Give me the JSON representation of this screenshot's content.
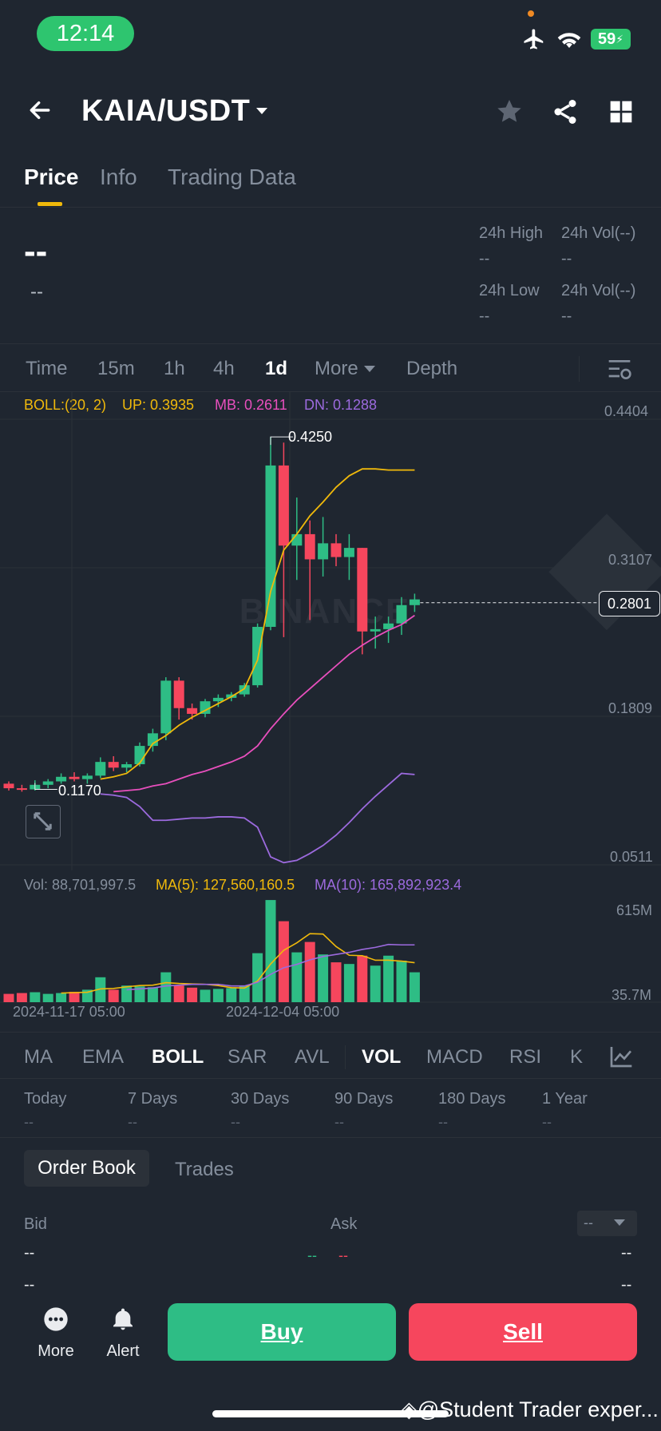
{
  "status_bar": {
    "time": "12:14",
    "battery": "59"
  },
  "header": {
    "pair": "KAIA/USDT"
  },
  "tabs": [
    "Price",
    "Info",
    "Trading Data"
  ],
  "price": {
    "last": "--",
    "sub": "--",
    "high_label": "24h High",
    "high_value": "--",
    "vol1_label": "24h Vol(--)",
    "vol1_value": "--",
    "low_label": "24h Low",
    "low_value": "--",
    "vol2_label": "24h Vol(--)",
    "vol2_value": "--"
  },
  "intervals": [
    "Time",
    "15m",
    "1h",
    "4h",
    "1d",
    "More",
    "Depth"
  ],
  "active_interval": "1d",
  "boll": {
    "label": "BOLL:(20, 2)",
    "up": "UP: 0.3935",
    "mb": "MB: 0.2611",
    "dn": "DN: 0.1288"
  },
  "vol_legend": {
    "vol": "Vol: 88,701,997.5",
    "ma5": "MA(5): 127,560,160.5",
    "ma10": "MA(10): 165,892,923.4"
  },
  "chart_data": {
    "type": "candlestick",
    "y_axis_labels": [
      "0.4404",
      "0.3107",
      "0.1809",
      "0.0511"
    ],
    "ylim": [
      0.0511,
      0.4404
    ],
    "current_price": "0.2801",
    "high_marker": "0.4250",
    "low_marker": "0.1170",
    "x_labels": [
      "2024-11-17 05:00",
      "2024-12-04 05:00"
    ],
    "volume_axis_labels": [
      "615M",
      "35.7M"
    ],
    "candles": [
      {
        "o": 0.122,
        "h": 0.124,
        "l": 0.116,
        "c": 0.118
      },
      {
        "o": 0.118,
        "h": 0.121,
        "l": 0.115,
        "c": 0.117
      },
      {
        "o": 0.117,
        "h": 0.125,
        "l": 0.116,
        "c": 0.121
      },
      {
        "o": 0.121,
        "h": 0.126,
        "l": 0.118,
        "c": 0.124
      },
      {
        "o": 0.124,
        "h": 0.131,
        "l": 0.122,
        "c": 0.128
      },
      {
        "o": 0.128,
        "h": 0.132,
        "l": 0.124,
        "c": 0.126
      },
      {
        "o": 0.126,
        "h": 0.131,
        "l": 0.122,
        "c": 0.129
      },
      {
        "o": 0.129,
        "h": 0.145,
        "l": 0.127,
        "c": 0.141
      },
      {
        "o": 0.141,
        "h": 0.146,
        "l": 0.133,
        "c": 0.136
      },
      {
        "o": 0.136,
        "h": 0.141,
        "l": 0.132,
        "c": 0.139
      },
      {
        "o": 0.139,
        "h": 0.158,
        "l": 0.137,
        "c": 0.155
      },
      {
        "o": 0.155,
        "h": 0.17,
        "l": 0.15,
        "c": 0.166
      },
      {
        "o": 0.166,
        "h": 0.215,
        "l": 0.16,
        "c": 0.212
      },
      {
        "o": 0.212,
        "h": 0.215,
        "l": 0.178,
        "c": 0.188
      },
      {
        "o": 0.188,
        "h": 0.192,
        "l": 0.178,
        "c": 0.183
      },
      {
        "o": 0.183,
        "h": 0.196,
        "l": 0.18,
        "c": 0.194
      },
      {
        "o": 0.194,
        "h": 0.2,
        "l": 0.189,
        "c": 0.197
      },
      {
        "o": 0.197,
        "h": 0.202,
        "l": 0.194,
        "c": 0.2
      },
      {
        "o": 0.2,
        "h": 0.21,
        "l": 0.198,
        "c": 0.208
      },
      {
        "o": 0.208,
        "h": 0.262,
        "l": 0.206,
        "c": 0.259
      },
      {
        "o": 0.259,
        "h": 0.425,
        "l": 0.256,
        "c": 0.4
      },
      {
        "o": 0.4,
        "h": 0.42,
        "l": 0.25,
        "c": 0.33
      },
      {
        "o": 0.33,
        "h": 0.372,
        "l": 0.3,
        "c": 0.34
      },
      {
        "o": 0.34,
        "h": 0.352,
        "l": 0.265,
        "c": 0.318
      },
      {
        "o": 0.318,
        "h": 0.355,
        "l": 0.303,
        "c": 0.332
      },
      {
        "o": 0.332,
        "h": 0.34,
        "l": 0.312,
        "c": 0.32
      },
      {
        "o": 0.32,
        "h": 0.34,
        "l": 0.3,
        "c": 0.328
      },
      {
        "o": 0.328,
        "h": 0.328,
        "l": 0.235,
        "c": 0.255
      },
      {
        "o": 0.255,
        "h": 0.268,
        "l": 0.24,
        "c": 0.257
      },
      {
        "o": 0.257,
        "h": 0.268,
        "l": 0.245,
        "c": 0.262
      },
      {
        "o": 0.262,
        "h": 0.285,
        "l": 0.252,
        "c": 0.278
      },
      {
        "o": 0.278,
        "h": 0.288,
        "l": 0.272,
        "c": 0.283
      }
    ],
    "up_band": [
      null,
      null,
      null,
      null,
      null,
      null,
      null,
      0.126,
      0.128,
      0.131,
      0.14,
      0.157,
      0.164,
      0.173,
      0.18,
      0.186,
      0.192,
      0.198,
      0.205,
      0.23,
      0.29,
      0.326,
      0.34,
      0.356,
      0.368,
      0.381,
      0.391,
      0.397,
      0.397,
      0.396,
      0.396,
      0.396
    ],
    "mid_band": [
      null,
      null,
      null,
      null,
      null,
      null,
      null,
      null,
      0.115,
      0.116,
      0.117,
      0.12,
      0.122,
      0.126,
      0.13,
      0.133,
      0.137,
      0.141,
      0.146,
      0.155,
      0.17,
      0.183,
      0.195,
      0.205,
      0.215,
      0.225,
      0.235,
      0.243,
      0.25,
      0.256,
      0.261,
      0.269
    ],
    "dn_band": [
      null,
      null,
      null,
      null,
      null,
      null,
      null,
      0.113,
      0.112,
      0.11,
      0.102,
      0.09,
      0.09,
      0.091,
      0.092,
      0.092,
      0.093,
      0.093,
      0.092,
      0.084,
      0.058,
      0.053,
      0.055,
      0.061,
      0.068,
      0.077,
      0.088,
      0.1,
      0.111,
      0.121,
      0.131,
      0.13
    ],
    "volumes": [
      20,
      22,
      24,
      20,
      22,
      25,
      30,
      60,
      30,
      40,
      38,
      36,
      72,
      40,
      35,
      30,
      32,
      34,
      40,
      118,
      246,
      195,
      120,
      145,
      115,
      96,
      92,
      112,
      88,
      112,
      100,
      72
    ],
    "vol_ma5": [
      null,
      null,
      null,
      null,
      22,
      23,
      24,
      32,
      33,
      37,
      40,
      41,
      47,
      45,
      44,
      43,
      40,
      35,
      34,
      51,
      92,
      125,
      143,
      165,
      164,
      134,
      113,
      112,
      101,
      101,
      99,
      95
    ],
    "vol_ma10": [
      null,
      null,
      null,
      null,
      null,
      null,
      null,
      null,
      null,
      30,
      32,
      34,
      39,
      41,
      43,
      43,
      43,
      39,
      39,
      48,
      67,
      83,
      91,
      102,
      110,
      115,
      120,
      127,
      132,
      139,
      138,
      138
    ]
  },
  "indicators": [
    "MA",
    "EMA",
    "BOLL",
    "SAR",
    "AVL",
    "VOL",
    "MACD",
    "RSI",
    "K"
  ],
  "active_indicators": [
    "BOLL",
    "VOL"
  ],
  "performance": [
    {
      "label": "Today",
      "value": "--"
    },
    {
      "label": "7 Days",
      "value": "--"
    },
    {
      "label": "30 Days",
      "value": "--"
    },
    {
      "label": "90 Days",
      "value": "--"
    },
    {
      "label": "180 Days",
      "value": "--"
    },
    {
      "label": "1 Year",
      "value": "--"
    }
  ],
  "orderbook": {
    "tab_active": "Order Book",
    "tab_other": "Trades",
    "bid_label": "Bid",
    "ask_label": "Ask",
    "precision": "--",
    "bid_values": [
      "--",
      "--"
    ],
    "ask_values": [
      "--",
      "--"
    ],
    "mid_green": "--",
    "mid_red": "--"
  },
  "bottom": {
    "more": "More",
    "alert": "Alert",
    "buy": "Buy",
    "sell": "Sell"
  },
  "watermark": "@Student Trader exper...",
  "colors": {
    "up": "#2ebd85",
    "down": "#f6465d",
    "boll_up": "#f0b90b",
    "boll_mid": "#e84fbd",
    "boll_dn": "#9c6ade",
    "accent": "#f0b90b"
  }
}
